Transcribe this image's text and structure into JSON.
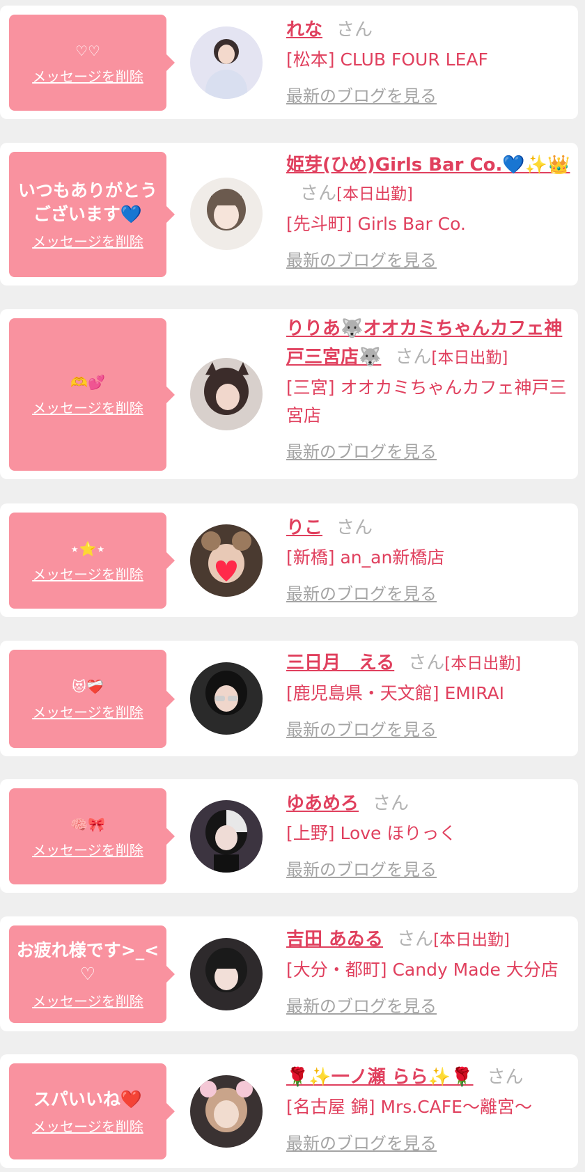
{
  "delete_label": "メッセージを削除",
  "san_label": "さん",
  "blog_label": "最新のブログを見る",
  "colors": {
    "accent": "#e0405e",
    "bubble": "#f9929f",
    "muted": "#a4a4a4"
  },
  "entries": [
    {
      "message": "♡♡",
      "name": "れな",
      "working": "",
      "shop": "[松本] CLUB FOUR LEAF"
    },
    {
      "message": "いつもありがとう\nございます💙",
      "name": "姫芽(ひめ)Girls Bar Co.💙✨👑",
      "working": "[本日出勤]",
      "shop": "[先斗町] Girls Bar Co."
    },
    {
      "message": "🫶💕",
      "name": "りりあ🐺オオカミちゃんカフェ神戸三宮店🐺",
      "working": "[本日出勤]",
      "shop": "[三宮] オオカミちゃんカフェ神戸三宮店"
    },
    {
      "message": "⋆⭐⋆",
      "name": "りこ",
      "working": "",
      "shop": "[新橋] an_an新橋店"
    },
    {
      "message": "😻❤️‍🩹",
      "name": "三日月　える",
      "working": "[本日出勤]",
      "shop": "[鹿児島県・天文館] EMIRAI"
    },
    {
      "message": "🧠🎀",
      "name": "ゆあめろ",
      "working": "",
      "shop": "[上野] Love ほりっく"
    },
    {
      "message": "お疲れ様です>_<\n♡",
      "name": "吉田 あゐる",
      "working": "[本日出勤]",
      "shop": "[大分・都町] Candy Made 大分店"
    },
    {
      "message": "スパいいね❤️",
      "name": "🌹✨一ノ瀬 らら✨🌹",
      "working": "",
      "shop": "[名古屋 錦] Mrs.CAFE〜離宮〜"
    }
  ]
}
